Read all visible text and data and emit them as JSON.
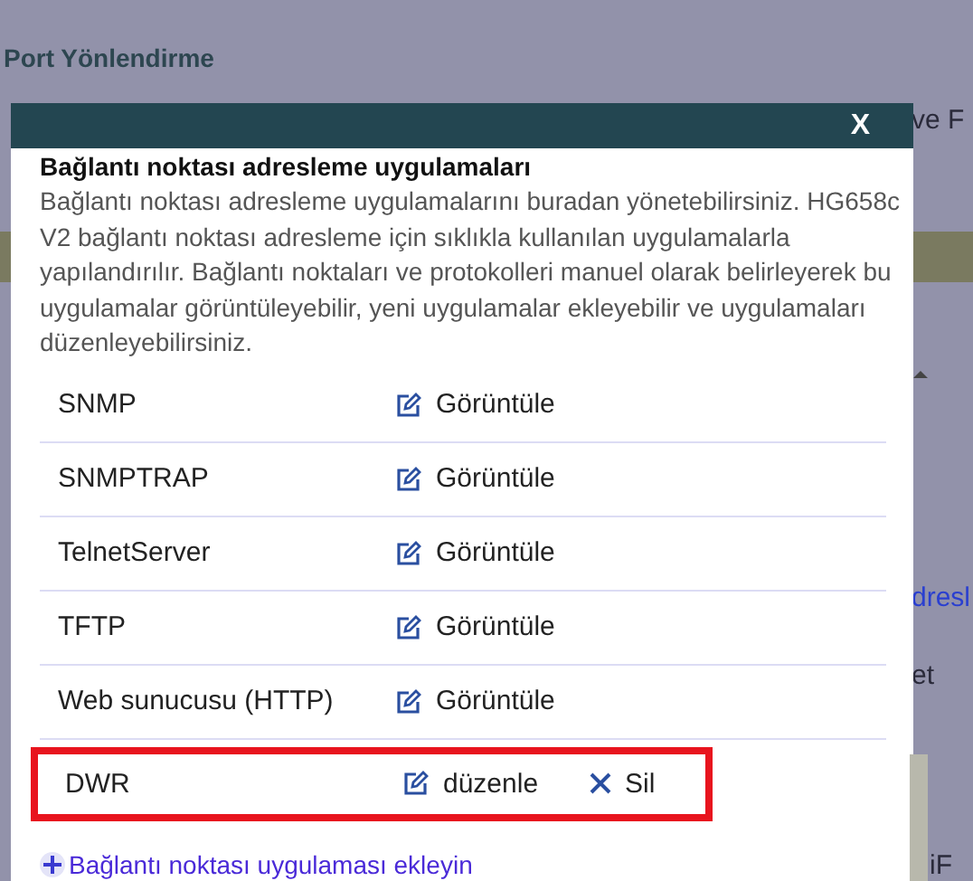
{
  "background": {
    "title": "Port Yönlendirme",
    "fragments": [
      {
        "kind": "dark",
        "text": "ve F"
      },
      {
        "kind": "link",
        "text": "dresl"
      },
      {
        "kind": "dark",
        "text": "et"
      },
      {
        "kind": "dark",
        "text": "iF"
      }
    ]
  },
  "dialog": {
    "close": "X",
    "heading": "Bağlantı noktası adresleme uygulamaları",
    "description": "Bağlantı noktası adresleme uygulamalarını buradan yönetebilirsiniz. HG658c V2 bağlantı noktası adresleme için sıklıkla kullanılan uygulamalarla yapılandırılır. Bağlantı noktaları ve protokolleri manuel olarak belirleyerek bu uygulamalar görüntüleyebilir, yeni uygulamalar ekleyebilir ve uygulamaları düzenleyebilirsiniz.",
    "apps": [
      {
        "name": "SNMP",
        "actions": [
          {
            "kind": "view",
            "label": "Görüntüle"
          }
        ],
        "highlighted": false
      },
      {
        "name": "SNMPTRAP",
        "actions": [
          {
            "kind": "view",
            "label": "Görüntüle"
          }
        ],
        "highlighted": false
      },
      {
        "name": "TelnetServer",
        "actions": [
          {
            "kind": "view",
            "label": "Görüntüle"
          }
        ],
        "highlighted": false
      },
      {
        "name": "TFTP",
        "actions": [
          {
            "kind": "view",
            "label": "Görüntüle"
          }
        ],
        "highlighted": false
      },
      {
        "name": "Web sunucusu (HTTP)",
        "actions": [
          {
            "kind": "view",
            "label": "Görüntüle"
          }
        ],
        "highlighted": false
      },
      {
        "name": "DWR",
        "actions": [
          {
            "kind": "edit",
            "label": "düzenle"
          },
          {
            "kind": "delete",
            "label": "Sil"
          }
        ],
        "highlighted": true
      }
    ],
    "add_link": "Bağlantı noktası uygulaması ekleyin"
  }
}
